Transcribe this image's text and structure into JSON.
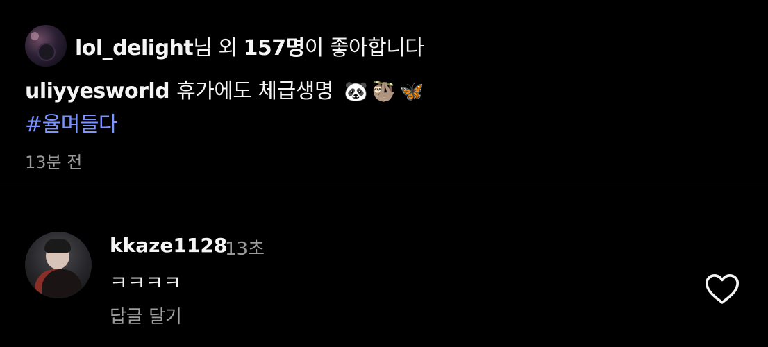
{
  "likes": {
    "username": "lol_delight",
    "text_mid": "님 외 ",
    "count": "157명",
    "text_end": "이 좋아합니다"
  },
  "post": {
    "author": "uliyyesworld",
    "caption": "휴가에도 체급생명",
    "emojis": [
      "🐼",
      "🦥",
      "🦋"
    ],
    "hashtag": "#율며들다",
    "time": "13분 전"
  },
  "comment": {
    "username": "kkaze1128",
    "time": "13초",
    "text": "ㅋㅋㅋㅋ",
    "reply_label": "답글 달기"
  },
  "icons": {
    "like": "heart-outline-icon"
  },
  "colors": {
    "background": "#000000",
    "hashtag": "#7a93ff",
    "secondary_text": "#9a9a9a"
  }
}
